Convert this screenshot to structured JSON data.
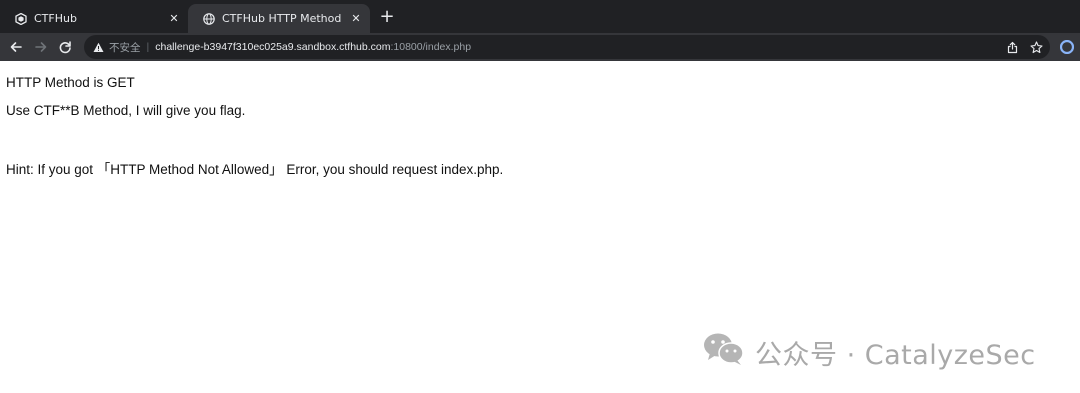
{
  "browser": {
    "tabs": [
      {
        "label": "CTFHub",
        "icon": "ctfhub-logo-icon",
        "active": false
      },
      {
        "label": "CTFHub HTTP Method",
        "icon": "globe-icon",
        "active": true
      }
    ],
    "close_glyph": "✕",
    "new_tab_glyph": "+",
    "address": {
      "security_text": "不安全",
      "separator": "|",
      "host": "challenge-b3947f310ec025a9.sandbox.ctfhub.com",
      "path": ":10800/index.php"
    },
    "colors": {
      "tabstrip": "#202124",
      "toolbar": "#35363a",
      "omnibox": "#202124",
      "profile": "#8ab4f8"
    }
  },
  "page": {
    "lines": [
      "HTTP Method is GET",
      "Use CTF**B Method, I will give you flag.",
      "Hint: If you got 「HTTP Method Not Allowed」 Error, you should request index.php."
    ]
  },
  "watermark": {
    "text": "公众号 · CatalyzeSec",
    "icon": "wechat-icon"
  }
}
